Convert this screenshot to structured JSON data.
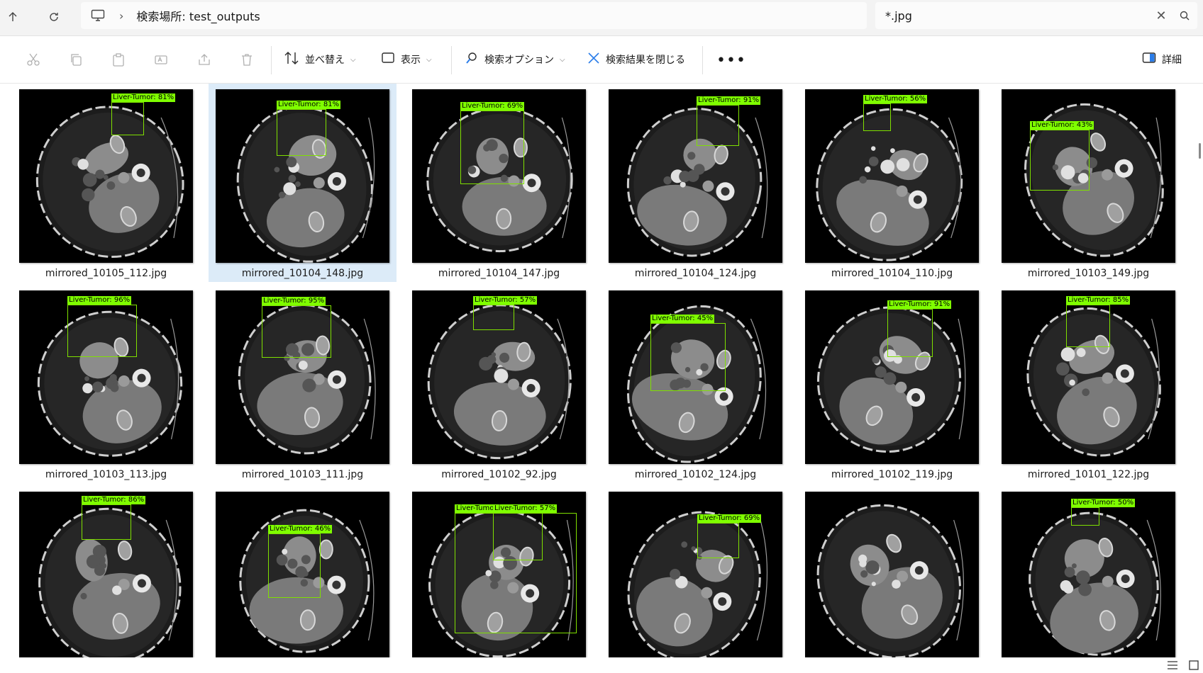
{
  "address": {
    "path": "検索場所: test_outputs"
  },
  "search": {
    "value": "*.jpg"
  },
  "toolbar": {
    "sort_label": "並べ替え",
    "view_label": "表示",
    "search_options_label": "検索オプション",
    "close_search_label": "検索結果を閉じる",
    "details_label": "詳細"
  },
  "colors": {
    "detection_box": "#7fe000",
    "selection_bg": "#dcebf8"
  },
  "files": [
    {
      "name": "mirrored_10105_112.jpg",
      "detections": [
        {
          "label": "Liver-Tumor: 81%"
        }
      ]
    },
    {
      "name": "mirrored_10104_148.jpg",
      "selected": true,
      "detections": [
        {
          "label": "Liver-Tumor: 81%"
        }
      ]
    },
    {
      "name": "mirrored_10104_147.jpg",
      "detections": [
        {
          "label": "Liver-Tumor: 69%"
        }
      ]
    },
    {
      "name": "mirrored_10104_124.jpg",
      "detections": [
        {
          "label": "Liver-Tumor: 91%"
        }
      ]
    },
    {
      "name": "mirrored_10104_110.jpg",
      "detections": [
        {
          "label": "Liver-Tumor: 56%"
        }
      ]
    },
    {
      "name": "mirrored_10103_149.jpg",
      "detections": [
        {
          "label": "Liver-Tumor: 43%"
        }
      ]
    },
    {
      "name": "mirrored_10103_113.jpg",
      "detections": [
        {
          "label": "Liver-Tumor: 96%"
        }
      ]
    },
    {
      "name": "mirrored_10103_111.jpg",
      "detections": [
        {
          "label": "Liver-Tumor: 95%"
        }
      ]
    },
    {
      "name": "mirrored_10102_92.jpg",
      "detections": [
        {
          "label": "Liver-Tumor: 57%"
        }
      ]
    },
    {
      "name": "mirrored_10102_124.jpg",
      "detections": [
        {
          "label": "Liver-Tumor: 45%"
        }
      ]
    },
    {
      "name": "mirrored_10102_119.jpg",
      "detections": [
        {
          "label": "Liver-Tumor: 91%"
        }
      ]
    },
    {
      "name": "mirrored_10101_122.jpg",
      "detections": [
        {
          "label": "Liver-Tumor: 85%"
        }
      ]
    },
    {
      "name": "",
      "detections": [
        {
          "label": "Liver-Tumor: 86%"
        }
      ]
    },
    {
      "name": "",
      "detections": [
        {
          "label": "Liver-Tumor: 46%"
        }
      ]
    },
    {
      "name": "",
      "detections": [
        {
          "label": "Liver-Tumor: 50%"
        },
        {
          "label": "Liver-Tumor: 57%"
        }
      ]
    },
    {
      "name": "",
      "detections": [
        {
          "label": "Liver-Tumor: 69%"
        }
      ]
    },
    {
      "name": "",
      "detections": []
    },
    {
      "name": "",
      "detections": [
        {
          "label": "Liver-Tumor: 50%"
        }
      ]
    }
  ]
}
